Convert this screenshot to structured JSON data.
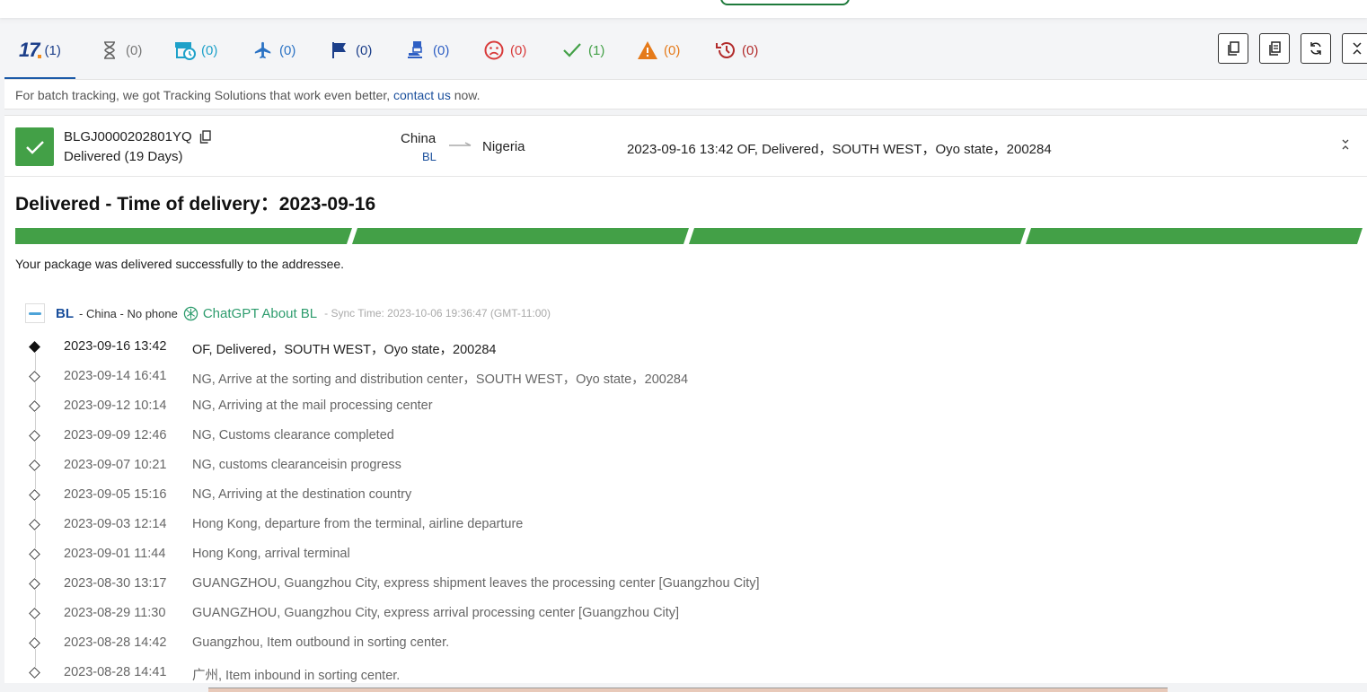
{
  "tabs": [
    {
      "name": "all",
      "count": "(1)",
      "color": "#1c3f8a"
    },
    {
      "name": "pending",
      "count": "(0)",
      "color": "#777777"
    },
    {
      "name": "info-received",
      "count": "(0)",
      "color": "#1ea1c9"
    },
    {
      "name": "in-transit",
      "count": "(0)",
      "color": "#2a72c4"
    },
    {
      "name": "pick-up",
      "count": "(0)",
      "color": "#1c3f8a"
    },
    {
      "name": "undelivered",
      "count": "(0)",
      "color": "#2e5fc4"
    },
    {
      "name": "alert",
      "count": "(0)",
      "color": "#d83a3a"
    },
    {
      "name": "delivered",
      "count": "(1)",
      "color": "#43a047"
    },
    {
      "name": "expired",
      "count": "(0)",
      "color": "#e57a1a"
    },
    {
      "name": "returned",
      "count": "(0)",
      "color": "#b22b2b"
    }
  ],
  "notice": {
    "prefix": "For batch tracking, we got Tracking Solutions that work even better, ",
    "link": "contact us",
    "suffix": " now."
  },
  "shipment": {
    "tracking_number": "BLGJ0000202801YQ",
    "status": "Delivered (19 Days)",
    "origin": "China",
    "origin_carrier": "BL",
    "destination": "Nigeria",
    "last_event": "2023-09-16 13:42  OF, Delivered，SOUTH WEST，Oyo state，200284"
  },
  "detail": {
    "headline": "Delivered - Time of delivery：2023-09-16",
    "progress_description": "Your package was delivered successfully to the addressee.",
    "progress_fraction": 1.0
  },
  "carrier": {
    "name": "BL",
    "meta": "- China  - No phone",
    "gpt_label": "ChatGPT About BL",
    "sync_time": "- Sync Time: 2023-10-06 19:36:47 (GMT-11:00)"
  },
  "events": [
    {
      "time": "2023-09-16 13:42",
      "desc": "OF, Delivered，SOUTH WEST，Oyo state，200284"
    },
    {
      "time": "2023-09-14 16:41",
      "desc": "NG, Arrive at the sorting and distribution center，SOUTH WEST，Oyo state，200284"
    },
    {
      "time": "2023-09-12 10:14",
      "desc": "NG, Arriving at the mail processing center"
    },
    {
      "time": "2023-09-09 12:46",
      "desc": "NG, Customs clearance completed"
    },
    {
      "time": "2023-09-07 10:21",
      "desc": "NG, customs clearanceisin progress"
    },
    {
      "time": "2023-09-05 15:16",
      "desc": "NG, Arriving at the destination country"
    },
    {
      "time": "2023-09-03 12:14",
      "desc": "Hong Kong, departure from the terminal, airline departure"
    },
    {
      "time": "2023-09-01 11:44",
      "desc": "Hong Kong, arrival terminal"
    },
    {
      "time": "2023-08-30 13:17",
      "desc": "GUANGZHOU, Guangzhou City, express shipment leaves the processing center [Guangzhou City]"
    },
    {
      "time": "2023-08-29 11:30",
      "desc": "GUANGZHOU, Guangzhou City, express arrival processing center [Guangzhou City]"
    },
    {
      "time": "2023-08-28 14:42",
      "desc": "Guangzhou, Item outbound in sorting center."
    },
    {
      "time": "2023-08-28 14:41",
      "desc": "广州, Item inbound in sorting center."
    }
  ],
  "colors": {
    "delivered_green": "#43a047",
    "link_blue": "#1a4f9c",
    "gpt_green": "#2d9c6d"
  }
}
